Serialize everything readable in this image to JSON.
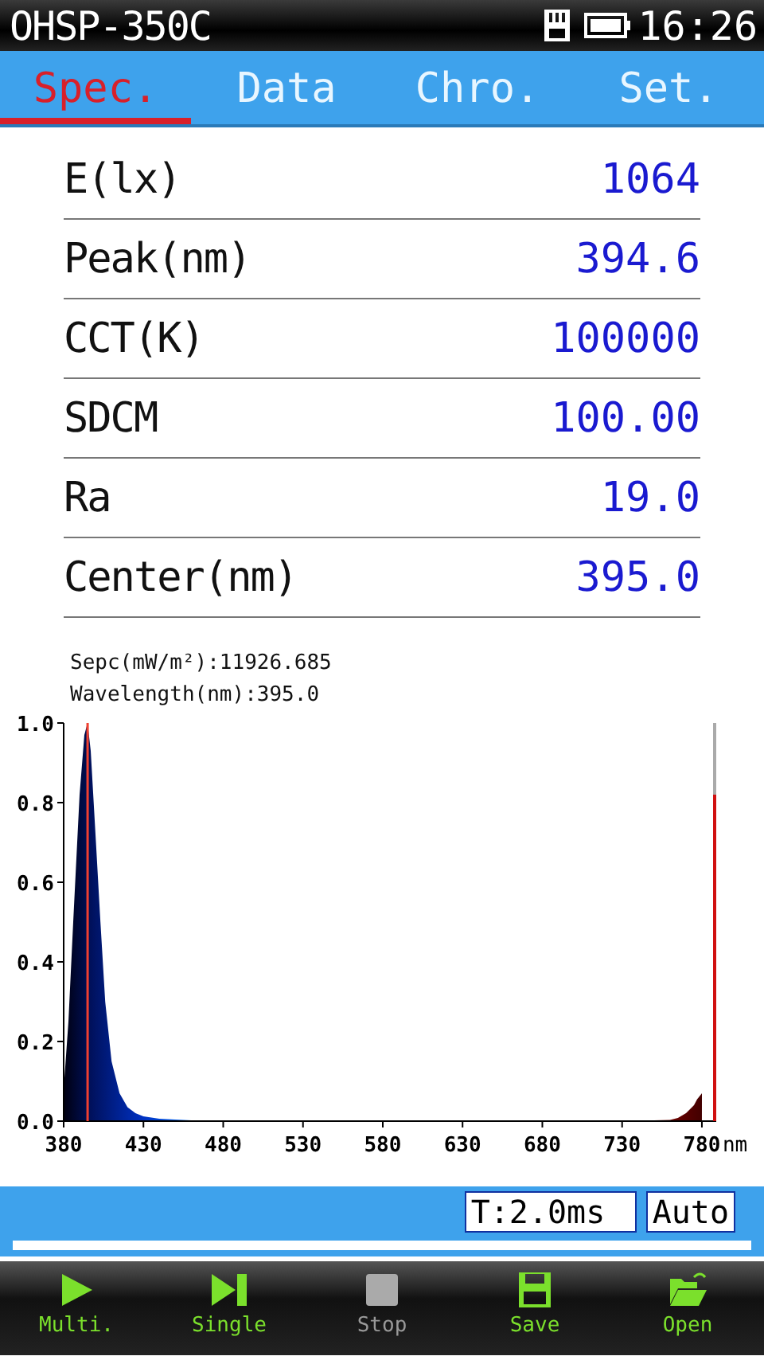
{
  "status_bar": {
    "title": "OHSP-350C",
    "time": "16:26"
  },
  "tabs": [
    {
      "label": "Spec.",
      "selected": true
    },
    {
      "label": "Data",
      "selected": false
    },
    {
      "label": "Chro.",
      "selected": false
    },
    {
      "label": "Set.",
      "selected": false
    }
  ],
  "measurements": [
    {
      "label": "E(lx)",
      "value": "1064"
    },
    {
      "label": "Peak(nm)",
      "value": "394.6"
    },
    {
      "label": "CCT(K)",
      "value": "100000"
    },
    {
      "label": "SDCM",
      "value": "100.00"
    },
    {
      "label": "Ra",
      "value": "19.0"
    },
    {
      "label": "Center(nm)",
      "value": "395.0"
    }
  ],
  "spectrum": {
    "readouts": [
      "Sepc(mW/m²):11926.685",
      "Wavelength(nm):395.0"
    ],
    "chart_data": {
      "type": "area",
      "xlabel": "nm",
      "x": [
        380,
        383,
        386,
        390,
        393,
        395,
        397,
        400,
        403,
        406,
        410,
        415,
        420,
        425,
        430,
        440,
        460,
        480,
        530,
        580,
        630,
        680,
        730,
        760,
        765,
        770,
        775,
        777,
        780
      ],
      "series": [
        {
          "values": [
            0.08,
            0.25,
            0.5,
            0.82,
            0.97,
            1.0,
            0.93,
            0.72,
            0.5,
            0.3,
            0.15,
            0.07,
            0.035,
            0.02,
            0.012,
            0.006,
            0.002,
            0.0,
            0.0,
            0.0,
            0.0,
            0.0,
            0.0,
            0.003,
            0.008,
            0.02,
            0.04,
            0.055,
            0.07
          ]
        }
      ],
      "xlim": [
        380,
        789
      ],
      "ylim": [
        0,
        1
      ],
      "xticks": [
        380,
        430,
        480,
        530,
        580,
        630,
        680,
        730,
        780
      ],
      "yticks": [
        {
          "value": 0,
          "label": "0.0"
        },
        {
          "value": 0.2,
          "label": "0.2"
        },
        {
          "value": 0.4,
          "label": "0.4"
        },
        {
          "value": 0.6,
          "label": "0.6"
        },
        {
          "value": 0.8,
          "label": "0.8"
        },
        {
          "value": 1,
          "label": "1.0"
        }
      ]
    }
  },
  "exposure": {
    "time": "T:2.0ms",
    "mode": "Auto"
  },
  "toolbar": [
    {
      "kind": "play",
      "label": "Multi.",
      "disabled": false
    },
    {
      "kind": "step",
      "label": "Single",
      "disabled": false
    },
    {
      "kind": "stop",
      "label": "Stop",
      "disabled": true
    },
    {
      "kind": "save",
      "label": "Save",
      "disabled": false
    },
    {
      "kind": "open",
      "label": "Open",
      "disabled": false
    }
  ]
}
